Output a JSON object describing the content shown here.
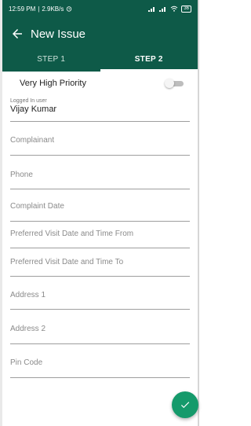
{
  "status_bar": {
    "time": "12:59 PM",
    "speed": "2.9KB/s",
    "battery": "36"
  },
  "app_bar": {
    "title": "New Issue"
  },
  "tabs": [
    {
      "label": "STEP 1",
      "active": false
    },
    {
      "label": "STEP 2",
      "active": true
    }
  ],
  "priority": {
    "label": "Very High Priority",
    "enabled": false
  },
  "logged_in_user": {
    "label": "Logged In user",
    "value": "Vijay Kumar"
  },
  "fields": [
    {
      "placeholder": "Complainant"
    },
    {
      "placeholder": "Phone"
    },
    {
      "placeholder": "Complaint Date"
    },
    {
      "placeholder": "Preferred Visit Date and Time From"
    },
    {
      "placeholder": "Preferred Visit Date and Time To"
    },
    {
      "placeholder": "Address 1"
    },
    {
      "placeholder": "Address 2"
    },
    {
      "placeholder": "Pin Code"
    }
  ],
  "colors": {
    "primary": "#0e5a48",
    "fab": "#159a6b"
  }
}
